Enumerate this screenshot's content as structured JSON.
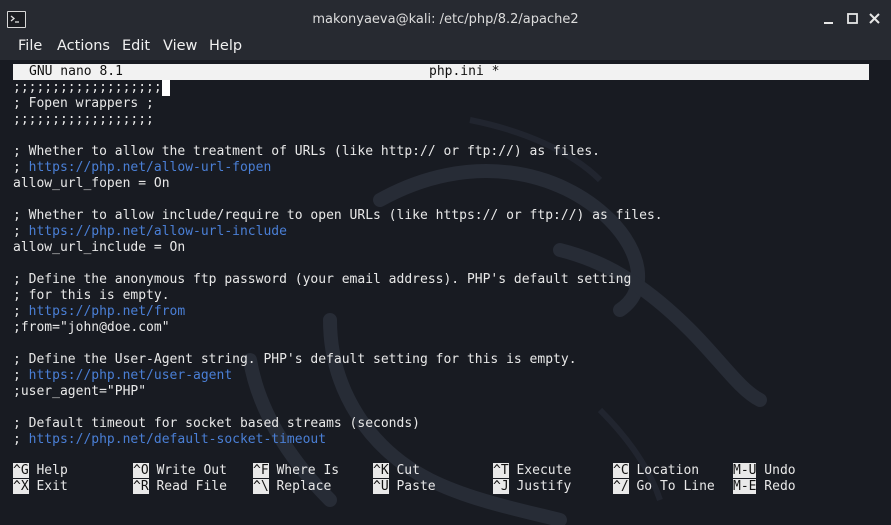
{
  "window": {
    "title": "makonyaeva@kali: /etc/php/8.2/apache2",
    "icon": "terminal-icon",
    "controls": [
      "minimize-icon",
      "maximize-icon",
      "close-icon"
    ]
  },
  "menu": {
    "file": "File",
    "actions": "Actions",
    "edit": "Edit",
    "view": "View",
    "help": "Help"
  },
  "nano": {
    "version": "GNU nano 8.1",
    "filename": "php.ini *"
  },
  "editor_lines": [
    {
      "text": ";;;;;;;;;;;;;;;;;;;",
      "url": "",
      "cursor": true
    },
    {
      "text": "; Fopen wrappers ;",
      "url": ""
    },
    {
      "text": ";;;;;;;;;;;;;;;;;;",
      "url": ""
    },
    {
      "text": "",
      "url": ""
    },
    {
      "text": "; Whether to allow the treatment of URLs (like http:// or ftp://) as files.",
      "url": ""
    },
    {
      "text": "; ",
      "url": "https://php.net/allow-url-fopen"
    },
    {
      "text": "allow_url_fopen = On",
      "url": ""
    },
    {
      "text": "",
      "url": ""
    },
    {
      "text": "; Whether to allow include/require to open URLs (like https:// or ftp://) as files.",
      "url": ""
    },
    {
      "text": "; ",
      "url": "https://php.net/allow-url-include"
    },
    {
      "text": "allow_url_include = On",
      "url": ""
    },
    {
      "text": "",
      "url": ""
    },
    {
      "text": "; Define the anonymous ftp password (your email address). PHP's default setting",
      "url": ""
    },
    {
      "text": "; for this is empty.",
      "url": ""
    },
    {
      "text": "; ",
      "url": "https://php.net/from"
    },
    {
      "text": ";from=\"john@doe.com\"",
      "url": ""
    },
    {
      "text": "",
      "url": ""
    },
    {
      "text": "; Define the User-Agent string. PHP's default setting for this is empty.",
      "url": ""
    },
    {
      "text": "; ",
      "url": "https://php.net/user-agent"
    },
    {
      "text": ";user_agent=\"PHP\"",
      "url": ""
    },
    {
      "text": "",
      "url": ""
    },
    {
      "text": "; Default timeout for socket based streams (seconds)",
      "url": ""
    },
    {
      "text": "; ",
      "url": "https://php.net/default-socket-timeout"
    }
  ],
  "shortcuts": [
    {
      "key": "^G",
      "label": "Help"
    },
    {
      "key": "^O",
      "label": "Write Out"
    },
    {
      "key": "^F",
      "label": "Where Is"
    },
    {
      "key": "^K",
      "label": "Cut"
    },
    {
      "key": "^T",
      "label": "Execute"
    },
    {
      "key": "^C",
      "label": "Location"
    },
    {
      "key": "M-U",
      "label": "Undo"
    },
    {
      "key": "^X",
      "label": "Exit"
    },
    {
      "key": "^R",
      "label": "Read File"
    },
    {
      "key": "^\\",
      "label": "Replace"
    },
    {
      "key": "^U",
      "label": "Paste"
    },
    {
      "key": "^J",
      "label": "Justify"
    },
    {
      "key": "^/",
      "label": "Go To Line"
    },
    {
      "key": "M-E",
      "label": "Redo"
    }
  ],
  "colors": {
    "background": "#181b22",
    "text": "#e8e8e8",
    "url": "#4a7fd6",
    "header_bg": "#f2f2f2"
  }
}
